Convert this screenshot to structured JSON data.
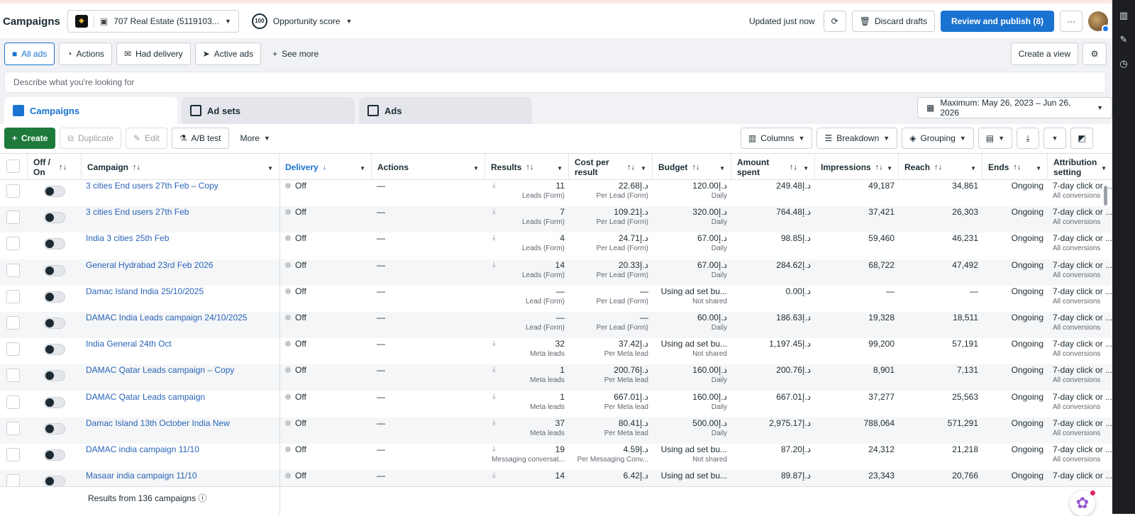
{
  "header": {
    "title": "Campaigns",
    "account_name": "707 Real Estate (5119103...",
    "opportunity_badge": "100",
    "opportunity_label": "Opportunity score",
    "updated": "Updated just now",
    "discard": "Discard drafts",
    "review": "Review and publish (8)",
    "more": "···"
  },
  "views": {
    "items": [
      "All ads",
      "Actions",
      "Had delivery",
      "Active ads"
    ],
    "see_more": "See more",
    "create_view": "Create a view"
  },
  "search": {
    "placeholder": "Describe what you're looking for"
  },
  "level_tabs": [
    "Campaigns",
    "Ad sets",
    "Ads"
  ],
  "date_range": "Maximum: May 26, 2023 – Jun 26, 2026",
  "toolbar": {
    "create": "Create",
    "duplicate": "Duplicate",
    "edit": "Edit",
    "ab_test": "A/B test",
    "more": "More",
    "columns": "Columns",
    "breakdown": "Breakdown",
    "grouping": "Grouping"
  },
  "columns": {
    "off_on": "Off / On",
    "campaign": "Campaign",
    "delivery": "Delivery",
    "actions": "Actions",
    "results": "Results",
    "cost_per_result": "Cost per result",
    "budget": "Budget",
    "amount_spent": "Amount spent",
    "impressions": "Impressions",
    "reach": "Reach",
    "ends": "Ends",
    "attribution": "Attribution setting"
  },
  "rows": [
    {
      "name": "3 cities End users 27th Feb – Copy",
      "delivery": "Off",
      "actions": "—",
      "results": "11",
      "results_sub": "Leads (Form)",
      "cpr": "22.68د.إ",
      "cpr_sub": "Per Lead (Form)",
      "budget": "120.00د.إ",
      "budget_sub": "Daily",
      "spent": "249.48د.إ",
      "impressions": "49,187",
      "reach": "34,861",
      "ends": "Ongoing",
      "attr": "7-day click or ...",
      "attr_sub": "All conversions"
    },
    {
      "name": "3 cities End users 27th Feb",
      "delivery": "Off",
      "actions": "—",
      "results": "7",
      "results_sub": "Leads (Form)",
      "cpr": "109.21د.إ",
      "cpr_sub": "Per Lead (Form)",
      "budget": "320.00د.إ",
      "budget_sub": "Daily",
      "spent": "764.48د.إ",
      "impressions": "37,421",
      "reach": "26,303",
      "ends": "Ongoing",
      "attr": "7-day click or ...",
      "attr_sub": "All conversions"
    },
    {
      "name": "India 3 cities 25th Feb",
      "delivery": "Off",
      "actions": "—",
      "results": "4",
      "results_sub": "Leads (Form)",
      "cpr": "24.71د.إ",
      "cpr_sub": "Per Lead (Form)",
      "budget": "67.00د.إ",
      "budget_sub": "Daily",
      "spent": "98.85د.إ",
      "impressions": "59,460",
      "reach": "46,231",
      "ends": "Ongoing",
      "attr": "7-day click or ...",
      "attr_sub": "All conversions"
    },
    {
      "name": "General Hydrabad 23rd Feb 2026",
      "delivery": "Off",
      "actions": "—",
      "results": "14",
      "results_sub": "Leads (Form)",
      "cpr": "20.33د.إ",
      "cpr_sub": "Per Lead (Form)",
      "budget": "67.00د.إ",
      "budget_sub": "Daily",
      "spent": "284.62د.إ",
      "impressions": "68,722",
      "reach": "47,492",
      "ends": "Ongoing",
      "attr": "7-day click or ...",
      "attr_sub": "All conversions"
    },
    {
      "name": "Damac Island India 25/10/2025",
      "delivery": "Off",
      "actions": "—",
      "results": "—",
      "results_sub": "Lead (Form)",
      "cpr": "—",
      "cpr_sub": "Per Lead (Form)",
      "budget": "Using ad set bu...",
      "budget_sub": "Not shared",
      "spent": "0.00د.إ",
      "impressions": "—",
      "reach": "—",
      "ends": "Ongoing",
      "attr": "7-day click or ...",
      "attr_sub": "All conversions"
    },
    {
      "name": "DAMAC India Leads campaign 24/10/2025",
      "delivery": "Off",
      "actions": "—",
      "results": "—",
      "results_sub": "Lead (Form)",
      "cpr": "—",
      "cpr_sub": "Per Lead (Form)",
      "budget": "60.00د.إ",
      "budget_sub": "Daily",
      "spent": "186.63د.إ",
      "impressions": "19,328",
      "reach": "18,511",
      "ends": "Ongoing",
      "attr": "7-day click or ...",
      "attr_sub": "All conversions"
    },
    {
      "name": "India General 24th Oct",
      "delivery": "Off",
      "actions": "—",
      "results": "32",
      "results_sub": "Meta leads",
      "cpr": "37.42د.إ",
      "cpr_sub": "Per Meta lead",
      "budget": "Using ad set bu...",
      "budget_sub": "Not shared",
      "spent": "1,197.45د.إ",
      "impressions": "99,200",
      "reach": "57,191",
      "ends": "Ongoing",
      "attr": "7-day click or ...",
      "attr_sub": "All conversions"
    },
    {
      "name": "DAMAC Qatar Leads campaign – Copy",
      "delivery": "Off",
      "actions": "—",
      "results": "1",
      "results_sub": "Meta leads",
      "cpr": "200.76د.إ",
      "cpr_sub": "Per Meta lead",
      "budget": "160.00د.إ",
      "budget_sub": "Daily",
      "spent": "200.76د.إ",
      "impressions": "8,901",
      "reach": "7,131",
      "ends": "Ongoing",
      "attr": "7-day click or ...",
      "attr_sub": "All conversions"
    },
    {
      "name": "DAMAC Qatar Leads campaign",
      "delivery": "Off",
      "actions": "—",
      "results": "1",
      "results_sub": "Meta leads",
      "cpr": "667.01د.إ",
      "cpr_sub": "Per Meta lead",
      "budget": "160.00د.إ",
      "budget_sub": "Daily",
      "spent": "667.01د.إ",
      "impressions": "37,277",
      "reach": "25,563",
      "ends": "Ongoing",
      "attr": "7-day click or ...",
      "attr_sub": "All conversions"
    },
    {
      "name": "Damac Island 13th October India New",
      "delivery": "Off",
      "actions": "—",
      "results": "37",
      "results_sub": "Meta leads",
      "cpr": "80.41د.إ",
      "cpr_sub": "Per Meta lead",
      "budget": "500.00د.إ",
      "budget_sub": "Daily",
      "spent": "2,975.17د.إ",
      "impressions": "788,064",
      "reach": "571,291",
      "ends": "Ongoing",
      "attr": "7-day click or ...",
      "attr_sub": "All conversions"
    },
    {
      "name": "DAMAC india campaign 11/10",
      "delivery": "Off",
      "actions": "—",
      "results": "19",
      "results_sub": "Messaging conversat...",
      "cpr": "4.59د.إ",
      "cpr_sub": "Per Messaging Conv...",
      "budget": "Using ad set bu...",
      "budget_sub": "Not shared",
      "spent": "87.20د.إ",
      "impressions": "24,312",
      "reach": "21,218",
      "ends": "Ongoing",
      "attr": "7-day click or ...",
      "attr_sub": "All conversions"
    },
    {
      "name": "Masaar india campaign 11/10",
      "delivery": "Off",
      "actions": "—",
      "results": "14",
      "results_sub": "",
      "cpr": "6.42د.إ",
      "cpr_sub": "",
      "budget": "Using ad set bu...",
      "budget_sub": "",
      "spent": "89.87د.إ",
      "impressions": "23,343",
      "reach": "20,766",
      "ends": "Ongoing",
      "attr": "7-day click or ...",
      "attr_sub": ""
    }
  ],
  "footer": {
    "summary": "Results from 136 campaigns"
  },
  "colors": {
    "accent": "#1a73d0",
    "create": "#1e7a3a",
    "link": "#2a64b8"
  }
}
